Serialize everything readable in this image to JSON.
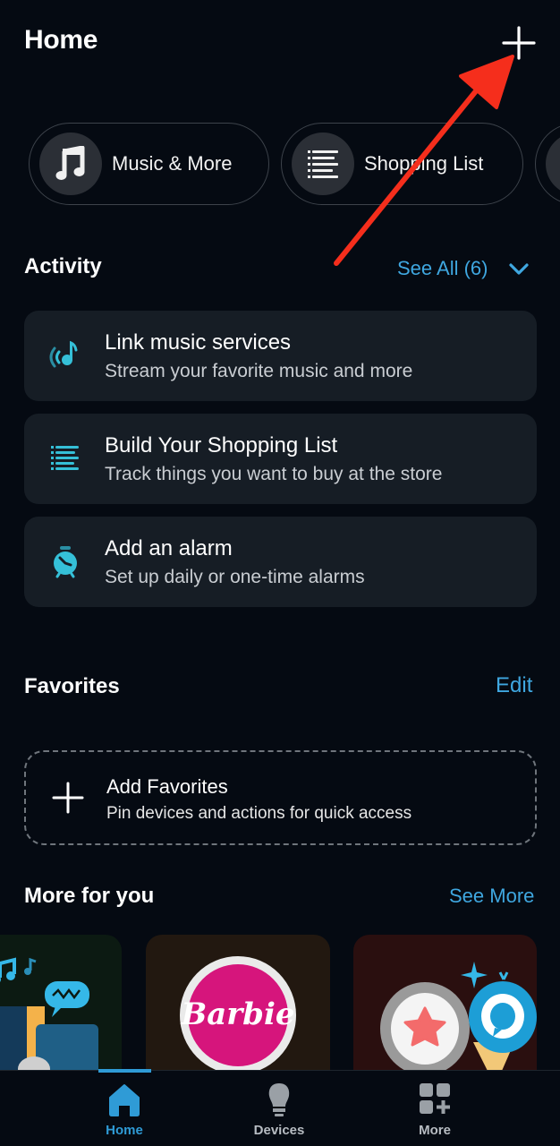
{
  "header": {
    "title": "Home",
    "add_icon": "plus-icon"
  },
  "quick_chips": [
    {
      "label": "Music & More",
      "icon": "music-note-icon"
    },
    {
      "label": "Shopping List",
      "icon": "list-icon"
    },
    {
      "label": "",
      "icon": "unknown-icon"
    }
  ],
  "activity": {
    "title": "Activity",
    "see_all_label": "See All (6)",
    "items": [
      {
        "title": "Link music services",
        "subtitle": "Stream your favorite music and more",
        "icon": "music-stream-icon"
      },
      {
        "title": "Build Your Shopping List",
        "subtitle": "Track things you want to buy at the store",
        "icon": "list-icon"
      },
      {
        "title": "Add an alarm",
        "subtitle": "Set up daily or one-time alarms",
        "icon": "alarm-clock-icon"
      }
    ]
  },
  "favorites": {
    "title": "Favorites",
    "edit_label": "Edit",
    "add_title": "Add Favorites",
    "add_subtitle": "Pin devices and actions for quick access"
  },
  "more_for_you": {
    "title": "More for you",
    "see_more_label": "See More",
    "cards": [
      {
        "name": "music-promo",
        "bg": "#0c1a12"
      },
      {
        "name": "barbie-promo",
        "text": "Barbie",
        "bg": "#221810"
      },
      {
        "name": "favorites-alexa-promo",
        "bg": "#2a0f0f"
      }
    ]
  },
  "tabbar": {
    "tabs": [
      {
        "label": "Home",
        "active": true
      },
      {
        "label": "Devices",
        "active": false
      },
      {
        "label": "More",
        "active": false
      }
    ]
  },
  "colors": {
    "background": "#050a12",
    "card": "#161d25",
    "accent": "#3fa7e0",
    "icon_teal": "#35c0d8",
    "annotation_arrow": "#f52e1c"
  }
}
